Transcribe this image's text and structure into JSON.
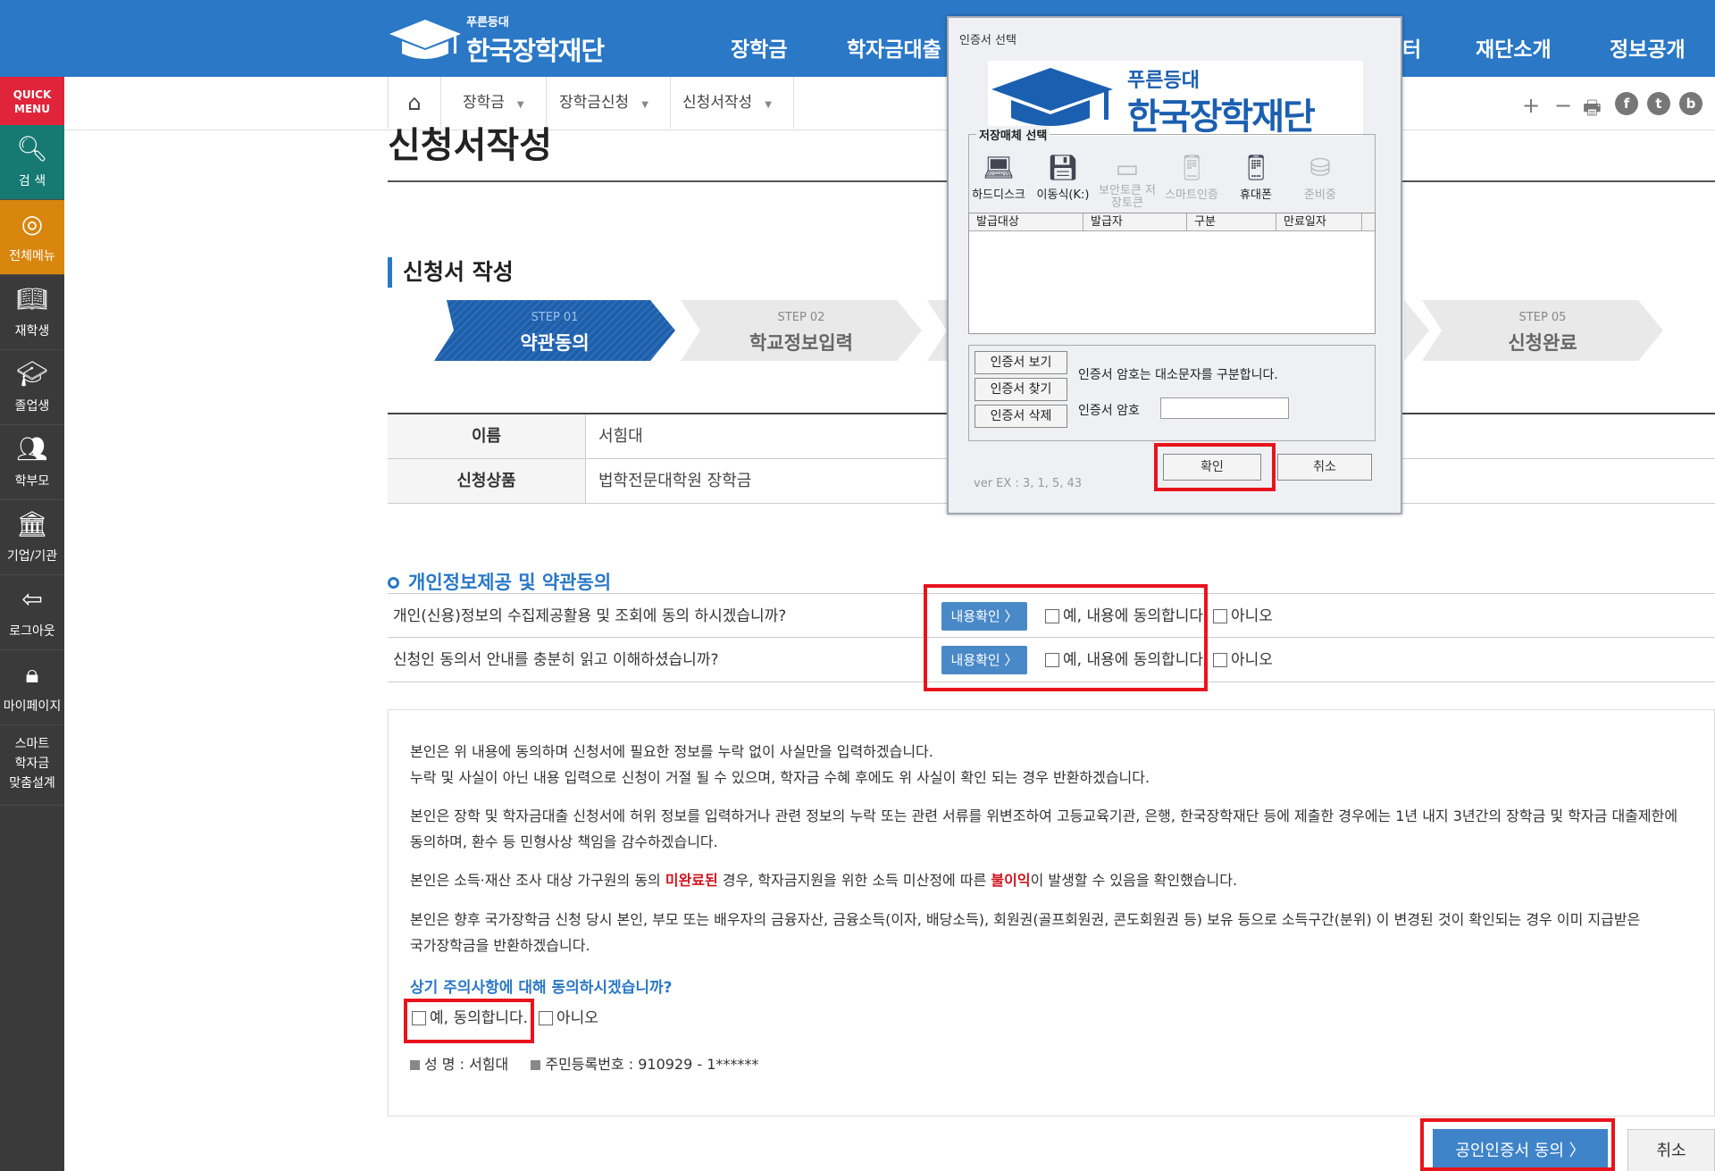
{
  "header": {
    "logo_sub": "푸른등대",
    "logo_main": "한국장학재단",
    "nav": [
      "장학금",
      "학자금대출",
      "터",
      "재단소개",
      "정보공개"
    ]
  },
  "breadcrumb": [
    "장학금",
    "장학금신청",
    "신청서작성"
  ],
  "utility": {
    "plus": "+",
    "minus": "−",
    "print": "🖶",
    "facebook": "f",
    "twitter": "t",
    "blog": "b"
  },
  "sidebar": {
    "quick_label_1": "QUICK",
    "quick_label_2": "MENU",
    "items": [
      {
        "label": "검 색",
        "icon": "search-icon"
      },
      {
        "label": "전체메뉴",
        "icon": "compass-icon"
      },
      {
        "label": "재학생",
        "icon": "book-icon"
      },
      {
        "label": "졸업생",
        "icon": "graduation-cap-icon"
      },
      {
        "label": "학부모",
        "icon": "people-icon"
      },
      {
        "label": "기업/기관",
        "icon": "building-icon"
      },
      {
        "label": "로그아웃",
        "icon": "logout-icon"
      },
      {
        "label": "마이페이지",
        "icon": "lock-icon"
      }
    ],
    "smart_1": "스마트",
    "smart_2": "학자금",
    "smart_3": "맞춤설계"
  },
  "page": {
    "title": "신청서작성",
    "section_title": "신청서 작성",
    "steps": [
      {
        "num": "STEP 01",
        "label": "약관동의"
      },
      {
        "num": "STEP 02",
        "label": "학교정보입력"
      },
      {
        "num": "STEP 05",
        "label": "신청완료"
      }
    ]
  },
  "info": [
    {
      "label": "이름",
      "value": "서힘대"
    },
    {
      "label": "신청상품",
      "value": "법학전문대학원 장학금"
    }
  ],
  "agreement": {
    "title": "개인정보제공 및 약관동의",
    "rows": [
      {
        "question": "개인(신용)정보의 수집제공활용 및 조회에 동의 하시겠습니까?",
        "view_label": "내용확인 〉",
        "yes_label": "예, 내용에 동의합니다.",
        "no_label": "아니오"
      },
      {
        "question": "신청인 동의서 안내를 충분히 읽고 이해하셨습니까?",
        "view_label": "내용확인 〉",
        "yes_label": "예, 내용에 동의합니다.",
        "no_label": "아니오"
      }
    ]
  },
  "notice": {
    "p1a": "본인은 위 내용에 동의하며 신청서에 필요한 정보를 누락 없이 사실만을 입력하겠습니다.",
    "p1b": "누락 및 사실이 아닌 내용 입력으로 신청이 거절 될 수 있으며, 학자금 수혜 후에도 위 사실이 확인 되는 경우 반환하겠습니다.",
    "p2a": "본인은 장학 및 학자금대출 신청서에 허위 정보를 입력하거나 관련 정보의 누락 또는 관련 서류를 위변조하여 고등교육기관, 은행, 한국장학재단 등에 제출한 경우에는 1년 내지 3년간의 장학금 및 학자금 대출제한에",
    "p2b": "동의하며, 환수 등 민형사상 책임을 감수하겠습니다.",
    "p3_pre": "본인은 소득·재산 조사 대상 가구원의 동의 ",
    "p3_red1": "미완료된",
    "p3_mid": " 경우, 학자금지원을 위한 소득 미산정에 따른 ",
    "p3_red2": "불이익",
    "p3_post": "이 발생할 수 있음을 확인했습니다.",
    "p4a": "본인은 향후 국가장학금 신청 당시 본인, 부모 또는 배우자의 금융자산, 금융소득(이자, 배당소득), 회원권(골프회원권, 콘도회원권 등) 보유 등으로 소득구간(분위) 이 변경된 것이 확인되는 경우 이미 지급받은",
    "p4b": "국가장학금을 반환하겠습니다.",
    "question": "상기 주의사항에 대해 동의하시겠습니까?",
    "yes_label": "예, 동의합니다.",
    "no_label": "아니오",
    "name_line": "성 명 : 서힘대",
    "id_line": "주민등록번호 : 910929 - 1******"
  },
  "buttons": {
    "cert_agree": "공인인증서 동의   〉",
    "cancel": "취소"
  },
  "cert_dialog": {
    "title": "인증서 선택",
    "banner_sub": "푸른등대",
    "banner_main": "한국장학재단",
    "storage_label": "저장매체 선택",
    "media": [
      {
        "label": "하드디스크",
        "icon": "hard-disk-icon",
        "enabled": true
      },
      {
        "label": "이동식(K:)",
        "icon": "removable-disk-icon",
        "enabled": true
      },
      {
        "label": "보안토큰 저장토큰",
        "icon": "security-token-icon",
        "enabled": false
      },
      {
        "label": "스마트인증",
        "icon": "smart-auth-icon",
        "enabled": false
      },
      {
        "label": "휴대폰",
        "icon": "mobile-phone-icon",
        "enabled": true
      },
      {
        "label": "준비중",
        "icon": "pending-icon",
        "enabled": false
      }
    ],
    "columns": [
      "발급대상",
      "발급자",
      "구분",
      "만료일자"
    ],
    "view_cert": "인증서 보기",
    "find_cert": "인증서 찾기",
    "delete_cert": "인증서 삭제",
    "case_note": "인증서 암호는 대소문자를 구분합니다.",
    "pw_label": "인증서 암호",
    "ok": "확인",
    "cancel": "취소",
    "version": "ver EX : 3, 1, 5, 43"
  },
  "colors": {
    "brand_blue": "#2a78c6",
    "highlight_red": "#e8141c",
    "sidebar": "#3a3a3a"
  }
}
